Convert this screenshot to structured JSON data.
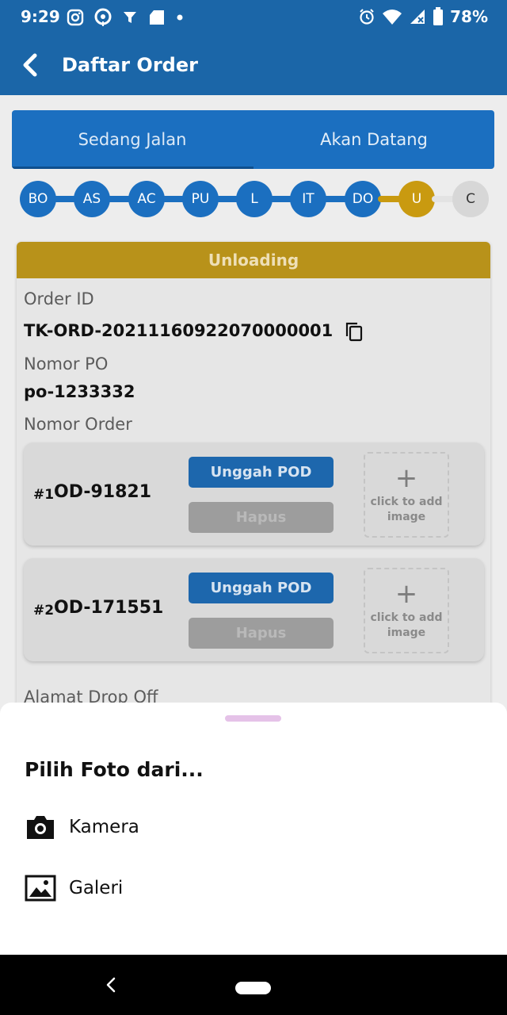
{
  "status_bar": {
    "time": "9:29",
    "battery": "78%",
    "left_icons": [
      "instagram-icon",
      "maps-icon",
      "filter-icon",
      "shop-icon",
      "dot-icon"
    ],
    "right_icons": [
      "alarm-icon",
      "wifi-icon",
      "signal-icon",
      "battery-icon"
    ]
  },
  "app_bar": {
    "title": "Daftar Order"
  },
  "tabs": [
    {
      "label": "Sedang Jalan",
      "active": true
    },
    {
      "label": "Akan Datang",
      "active": false
    }
  ],
  "steps": [
    {
      "label": "BO",
      "state": "done"
    },
    {
      "label": "AS",
      "state": "done"
    },
    {
      "label": "AC",
      "state": "done"
    },
    {
      "label": "PU",
      "state": "done"
    },
    {
      "label": "L",
      "state": "done"
    },
    {
      "label": "IT",
      "state": "done"
    },
    {
      "label": "DO",
      "state": "done"
    },
    {
      "label": "U",
      "state": "current"
    },
    {
      "label": "C",
      "state": "pending"
    }
  ],
  "order": {
    "status_header": "Unloading",
    "order_id_label": "Order ID",
    "order_id": "TK-ORD-20211160922070000001",
    "po_label": "Nomor PO",
    "po_number": "po-1233332",
    "order_no_label": "Nomor Order",
    "items": [
      {
        "no": "#1",
        "id": "OD-91821",
        "upload_label": "Unggah POD",
        "delete_label": "Hapus",
        "image_hint": "click to add image"
      },
      {
        "no": "#2",
        "id": "OD-171551",
        "upload_label": "Unggah POD",
        "delete_label": "Hapus",
        "image_hint": "click to add image"
      }
    ],
    "drop_off_label": "Alamat Drop Off"
  },
  "sheet": {
    "title": "Pilih Foto dari...",
    "options": [
      {
        "label": "Kamera",
        "icon": "camera-icon"
      },
      {
        "label": "Galeri",
        "icon": "gallery-icon"
      }
    ]
  },
  "colors": {
    "primary": "#1b66a8",
    "step_done": "#1b6fc0",
    "step_current": "#c99a10",
    "step_pending": "#d7d7d7",
    "header_unloading": "#b8921a"
  }
}
